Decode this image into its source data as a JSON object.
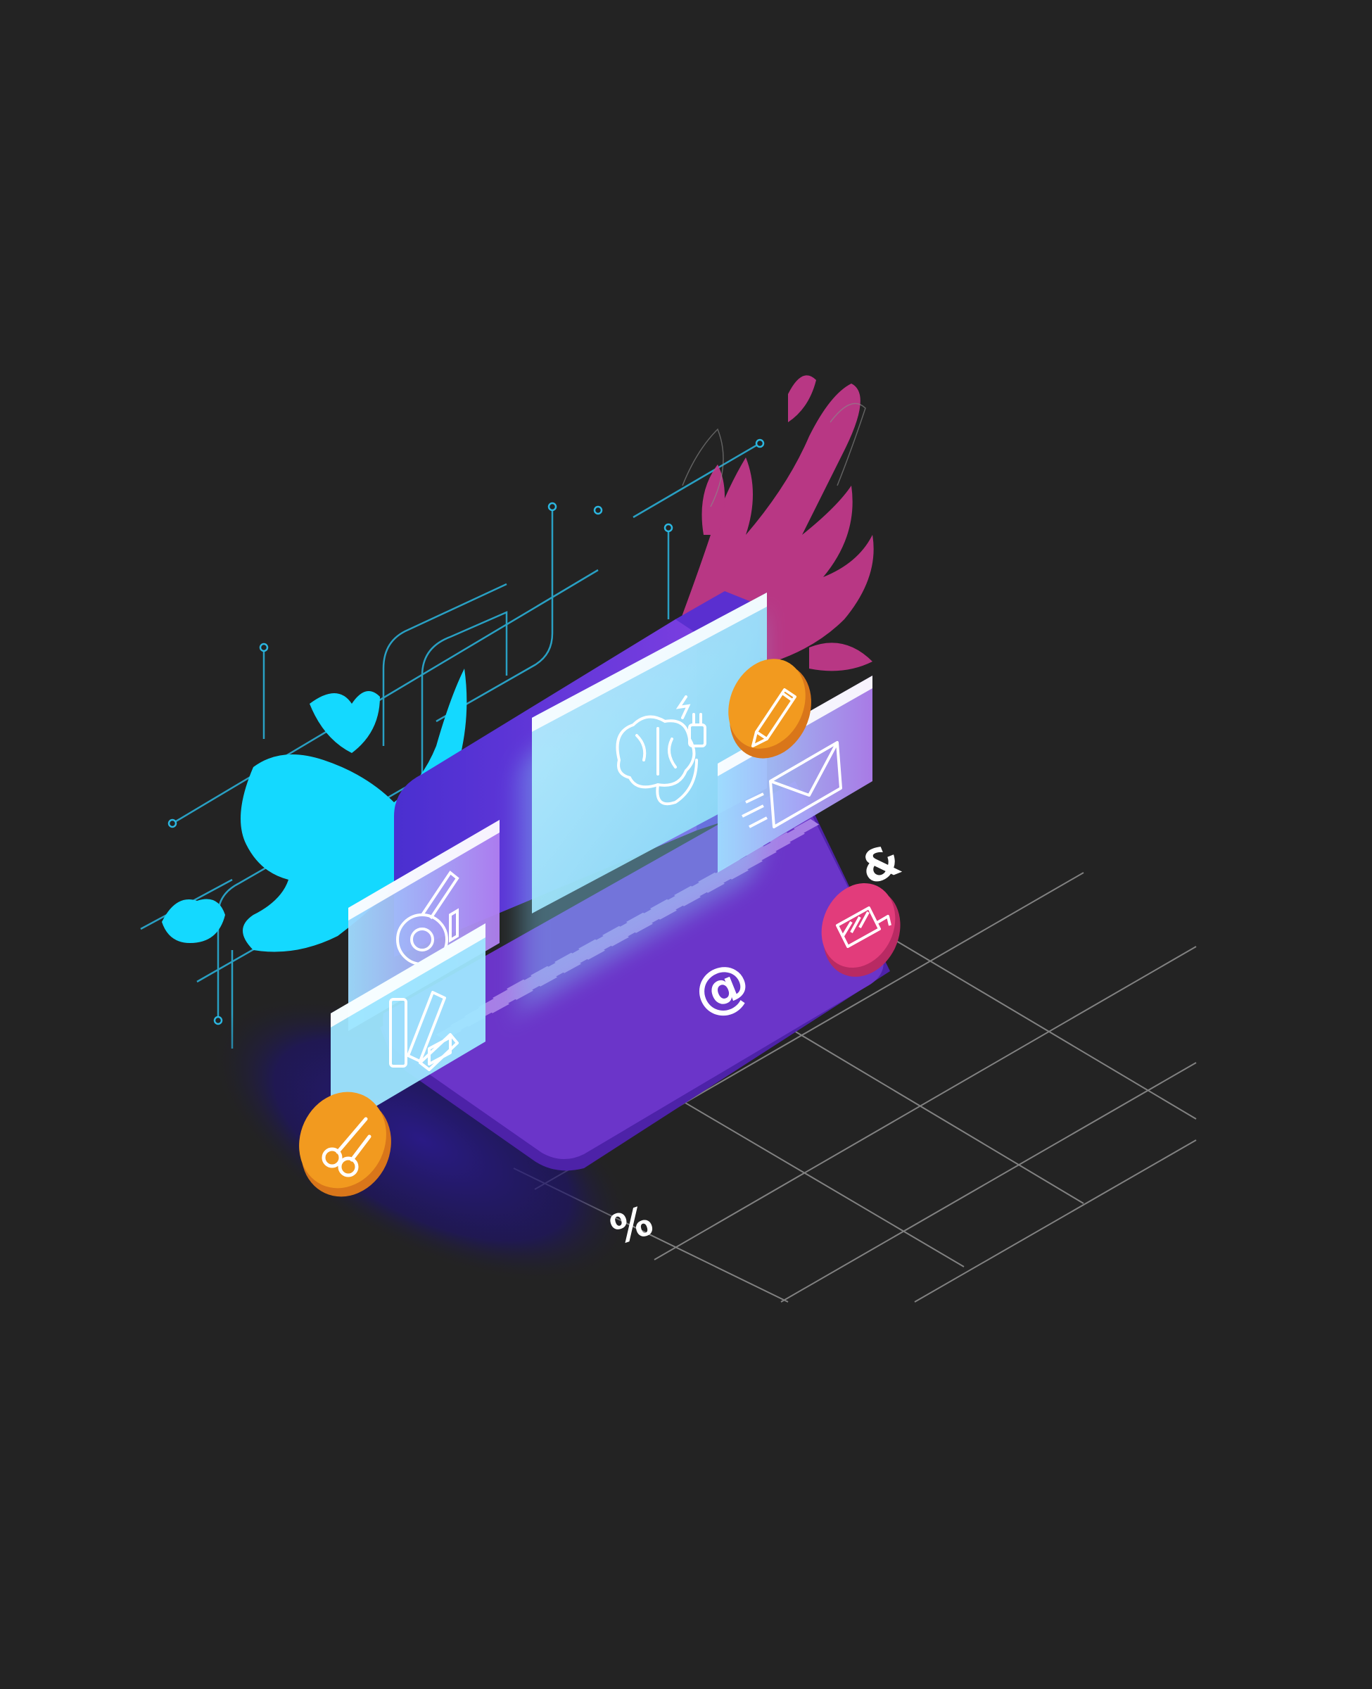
{
  "illustration": {
    "background_color": "#232323",
    "colors": {
      "laptop_purple": "#6b35c9",
      "keyboard_key": "#a77fe6",
      "cyan_splash": "#14d9ff",
      "magenta_splash": "#c93a8f",
      "orange_badge": "#f29a1f",
      "pink_badge": "#e23c7b",
      "grid_line": "#d8d8d8"
    },
    "floating_glyphs": {
      "percent": "%",
      "ampersand": "&",
      "at_sign": "@"
    },
    "icons": [
      "brain-plug-icon",
      "pencil-icon",
      "envelope-icon",
      "color-wheel-icon",
      "color-swatch-icon",
      "scissors-icon",
      "paint-brush-icon"
    ]
  }
}
